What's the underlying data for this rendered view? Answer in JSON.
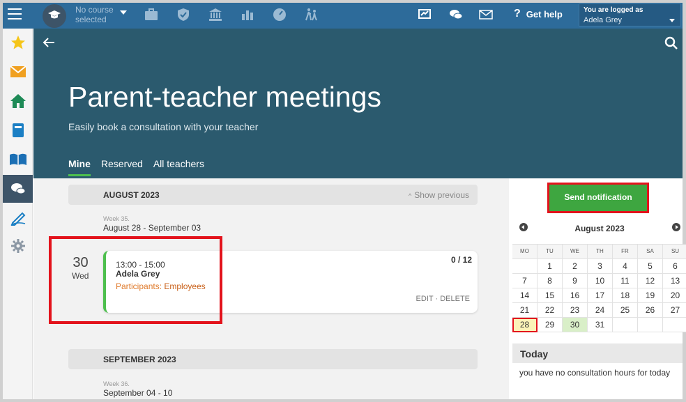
{
  "topbar": {
    "course_line1": "No course",
    "course_line2": "selected",
    "help_label": "Get help",
    "help_mark": "?",
    "logged_as_label": "You are logged as",
    "user_name": "Adela Grey",
    "icons": [
      "briefcase-icon",
      "shield-icon",
      "institution-icon",
      "bar-chart-icon",
      "gauge-icon",
      "walking-people-icon",
      "cast-icon",
      "chat-icon",
      "mail-icon"
    ]
  },
  "sidebar": {
    "items": [
      "star-icon",
      "mail-icon",
      "home-icon",
      "notebook-icon",
      "open-book-icon",
      "consultation-icon",
      "pen-icon",
      "settings-icon"
    ]
  },
  "header": {
    "title": "Parent-teacher meetings",
    "subtitle": "Easily book a consultation with your teacher",
    "tabs": [
      {
        "label": "Mine",
        "active": true
      },
      {
        "label": "Reserved",
        "active": false
      },
      {
        "label": "All teachers",
        "active": false
      }
    ]
  },
  "main": {
    "months": [
      {
        "label": "AUGUST 2023",
        "show_previous": "Show previous",
        "week_label": "Week 35.",
        "week_range": "August 28 - September 03",
        "day_number": "30",
        "day_name": "Wed",
        "event": {
          "time": "13:00 - 15:00",
          "name": "Adela Grey",
          "participants_label": "Participants:",
          "participants_value": "Employees",
          "count": "0 / 12",
          "edit": "EDIT",
          "separator": "·",
          "delete": "DELETE"
        }
      },
      {
        "label": "SEPTEMBER 2023",
        "week_label": "Week 36.",
        "week_range": "September 04 - 10"
      }
    ]
  },
  "right": {
    "send_button": "Send notification",
    "calendar": {
      "title": "August 2023",
      "weekdays": [
        "MO",
        "TU",
        "WE",
        "TH",
        "FR",
        "SA",
        "SU"
      ],
      "rows": [
        [
          "",
          "1",
          "2",
          "3",
          "4",
          "5",
          "6"
        ],
        [
          "7",
          "8",
          "9",
          "10",
          "11",
          "12",
          "13"
        ],
        [
          "14",
          "15",
          "16",
          "17",
          "18",
          "19",
          "20"
        ],
        [
          "21",
          "22",
          "23",
          "24",
          "25",
          "26",
          "27"
        ],
        [
          "28",
          "29",
          "30",
          "31",
          "",
          "",
          ""
        ]
      ],
      "today": "28",
      "event_day": "30"
    },
    "today_box": {
      "title": "Today",
      "text": "you have no consultation hours for today"
    }
  },
  "colors": {
    "topbar": "#2d6b9a",
    "header": "#2b5a6e",
    "accent_green": "#3ea640",
    "highlight_red": "#e3131c",
    "participants_orange": "#e07b2c"
  }
}
